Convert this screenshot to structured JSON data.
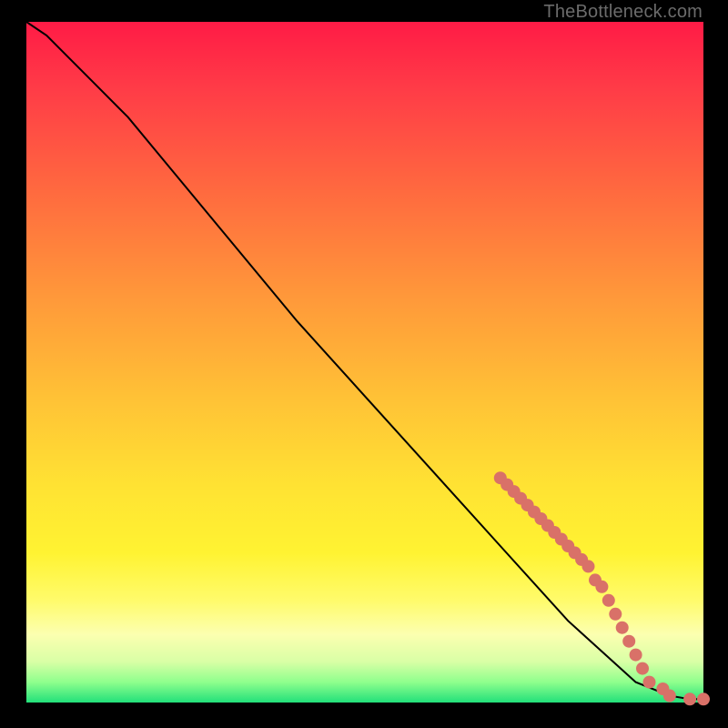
{
  "watermark": "TheBottleneck.com",
  "colors": {
    "marker": "#d97168",
    "curve": "#000000"
  },
  "chart_data": {
    "type": "line",
    "title": "",
    "xlabel": "",
    "ylabel": "",
    "xlim": [
      0,
      100
    ],
    "ylim": [
      0,
      100
    ],
    "grid": false,
    "legend": false,
    "curve": {
      "x": [
        0,
        3,
        6,
        10,
        15,
        20,
        30,
        40,
        50,
        60,
        70,
        80,
        90,
        95,
        98,
        100
      ],
      "y": [
        100,
        98,
        95,
        91,
        86,
        80,
        68,
        56,
        45,
        34,
        23,
        12,
        3,
        1,
        0.5,
        0.5
      ]
    },
    "markers": {
      "x": [
        70,
        71,
        72,
        73,
        74,
        75,
        76,
        77,
        78,
        79,
        80,
        81,
        82,
        83,
        84,
        85,
        86,
        87,
        88,
        89,
        90,
        91,
        92,
        94,
        95,
        98,
        100
      ],
      "y": [
        33,
        32,
        31,
        30,
        29,
        28,
        27,
        26,
        25,
        24,
        23,
        22,
        21,
        20,
        18,
        17,
        15,
        13,
        11,
        9,
        7,
        5,
        3,
        2,
        1,
        0.5,
        0.5
      ]
    }
  }
}
